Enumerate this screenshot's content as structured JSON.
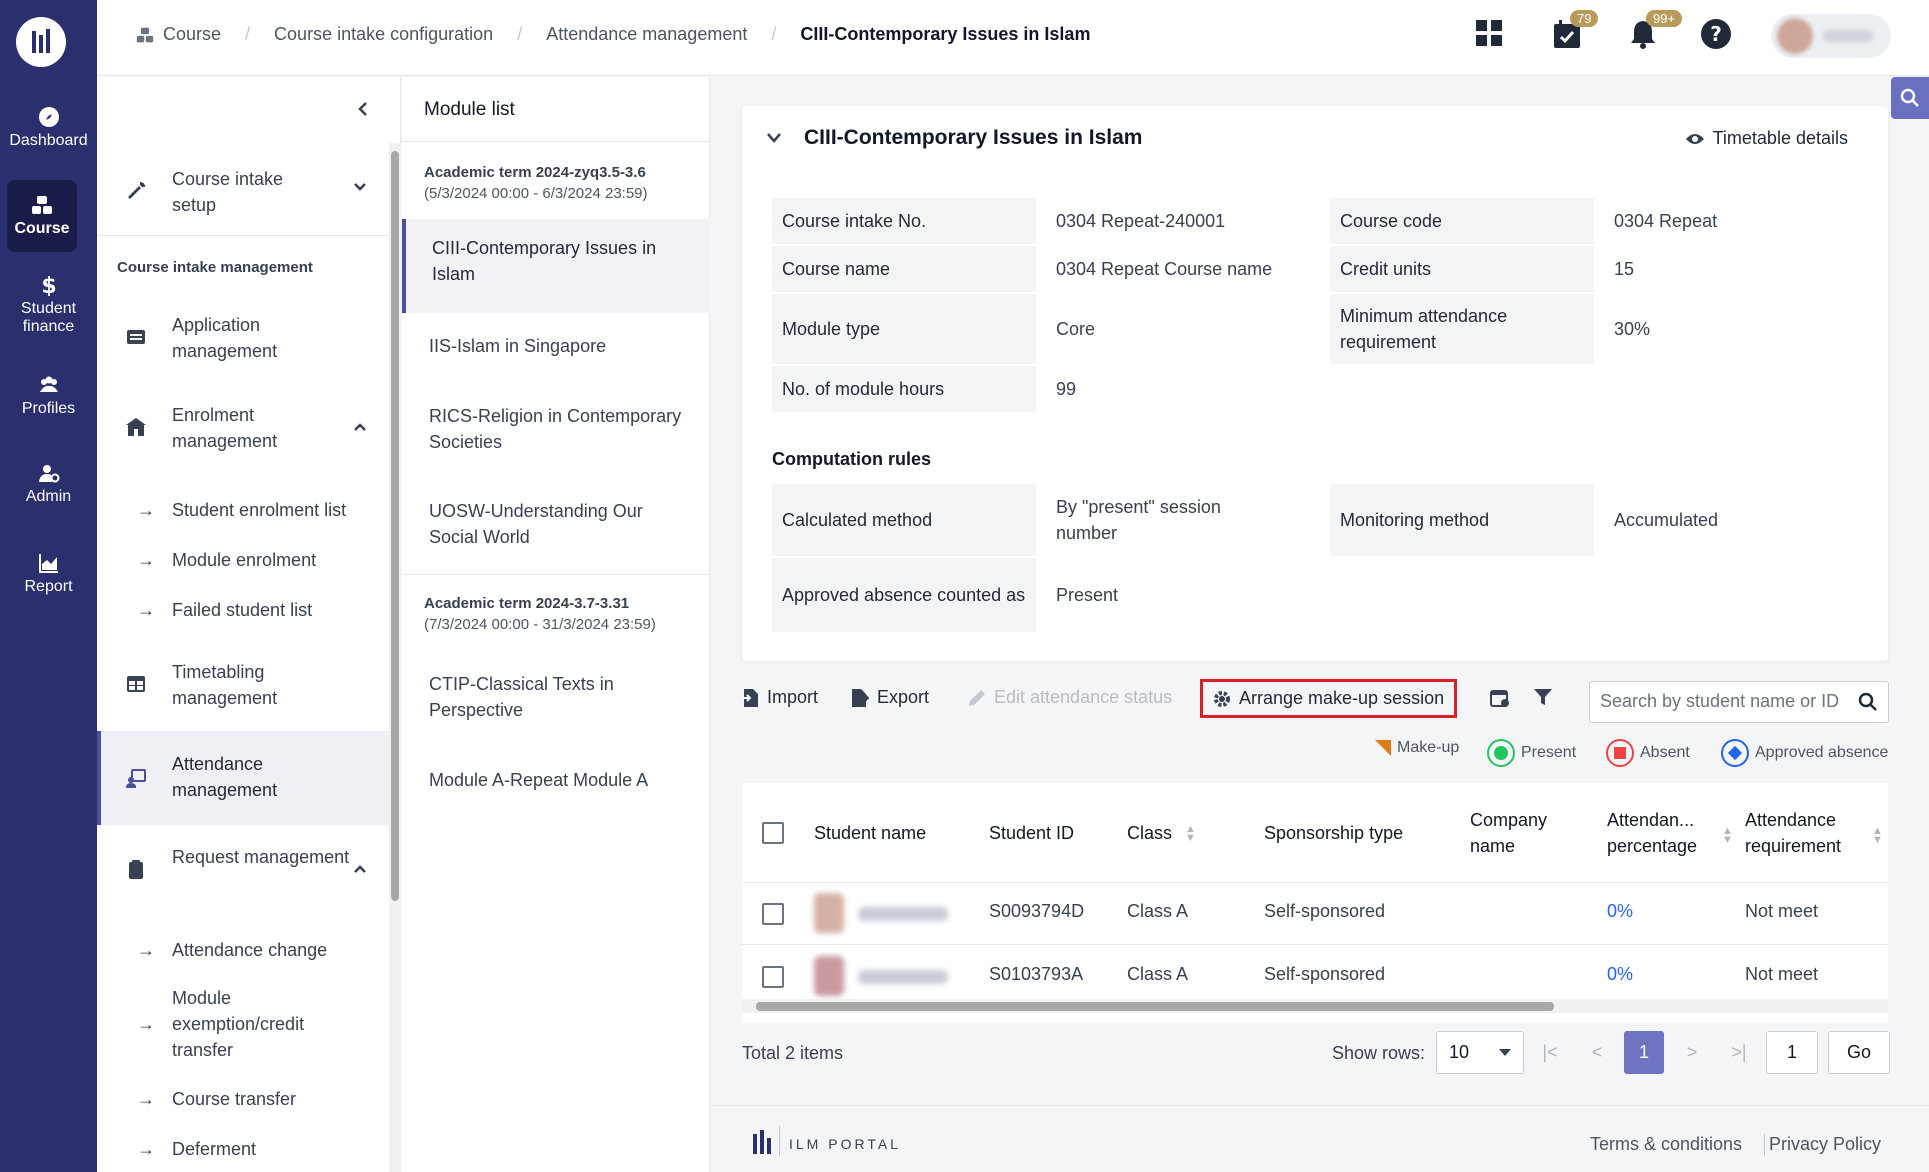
{
  "rail": {
    "items": [
      {
        "label": "Dashboard"
      },
      {
        "label": "Course"
      },
      {
        "label": "Student finance"
      },
      {
        "label": "Profiles"
      },
      {
        "label": "Admin"
      },
      {
        "label": "Report"
      }
    ]
  },
  "breadcrumb": [
    "Course",
    "Course intake configuration",
    "Attendance management",
    "CIII-Contemporary Issues in Islam"
  ],
  "topbar": {
    "calendar_badge": "79",
    "bell_badge": "99+"
  },
  "subnav": {
    "course_intake_setup": "Course intake setup",
    "group_title": "Course intake management",
    "application_management": "Application management",
    "enrolment_management": "Enrolment management",
    "student_enrolment_list": "Student enrolment list",
    "module_enrolment": "Module enrolment",
    "failed_student_list": "Failed student list",
    "timetabling_management": "Timetabling management",
    "attendance_management": "Attendance management",
    "request_management": "Request management",
    "attendance_change": "Attendance change",
    "module_exemption": "Module exemption/credit transfer",
    "course_transfer": "Course transfer",
    "deferment": "Deferment"
  },
  "modlist": {
    "title": "Module list",
    "term1": {
      "name": "Academic term 2024-zyq3.5-3.6",
      "range": "(5/3/2024 00:00 - 6/3/2024 23:59)"
    },
    "term1_modules": [
      "CIII-Contemporary Issues in Islam",
      "IIS-Islam in Singapore",
      "RICS-Religion in Contemporary Societies",
      "UOSW-Understanding Our Social World"
    ],
    "term2": {
      "name": "Academic term 2024-3.7-3.31",
      "range": "(7/3/2024 00:00 - 31/3/2024 23:59)"
    },
    "term2_modules": [
      "CTIP-Classical Texts in Perspective",
      "Module A-Repeat Module A"
    ]
  },
  "card": {
    "title": "CIII-Contemporary Issues in Islam",
    "timetable_link": "Timetable details",
    "fields": {
      "intake_no_label": "Course intake No.",
      "intake_no": "0304 Repeat-240001",
      "course_code_label": "Course code",
      "course_code": "0304 Repeat",
      "course_name_label": "Course name",
      "course_name": "0304 Repeat Course name",
      "credit_units_label": "Credit units",
      "credit_units": "15",
      "module_type_label": "Module type",
      "module_type": "Core",
      "min_att_label": "Minimum attendance requirement",
      "min_att": "30%",
      "hours_label": "No. of module hours",
      "hours": "99"
    },
    "computation_title": "Computation rules",
    "rules": {
      "calc_label": "Calculated method",
      "calc": "By \"present\" session number",
      "monitor_label": "Monitoring method",
      "monitor": "Accumulated",
      "absence_label": "Approved absence counted as",
      "absence": "Present"
    }
  },
  "toolbar": {
    "import": "Import",
    "export": "Export",
    "edit_status": "Edit attendance status",
    "arrange": "Arrange make-up session",
    "search_placeholder": "Search by student name or ID"
  },
  "legend": {
    "makeup": "Make-up",
    "present": "Present",
    "absent": "Absent",
    "approved": "Approved absence"
  },
  "colors": {
    "present": "#22c55e",
    "absent": "#ef4444",
    "approved": "#2563eb",
    "makeup": "#e07b1a",
    "highlight": "#d6202a",
    "accent": "#6f73c2"
  },
  "table": {
    "headers": {
      "name": "Student name",
      "id": "Student ID",
      "class": "Class",
      "sponsor": "Sponsorship type",
      "company": "Company name",
      "pct": "Attendan... percentage",
      "req": "Attendance requirement"
    },
    "rows": [
      {
        "id": "S0093794D",
        "class": "Class A",
        "sponsor": "Self-sponsored",
        "pct": "0%",
        "req": "Not meet"
      },
      {
        "id": "S0103793A",
        "class": "Class A",
        "sponsor": "Self-sponsored",
        "pct": "0%",
        "req": "Not meet"
      }
    ]
  },
  "pager": {
    "total": "Total 2 items",
    "show_rows_label": "Show rows:",
    "rows": "10",
    "current": "1",
    "goto": "1",
    "go": "Go"
  },
  "footer": {
    "brand": "ILM PORTAL",
    "terms": "Terms & conditions",
    "privacy": "Privacy Policy"
  }
}
